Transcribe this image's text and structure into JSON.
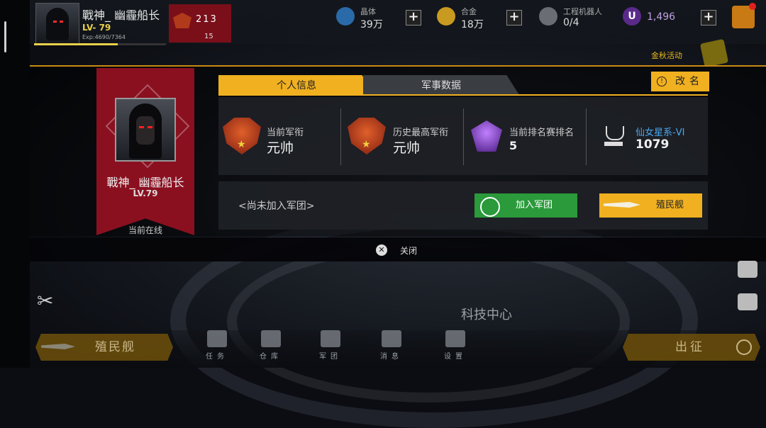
{
  "topbar": {
    "player_name": "戰神_ 幽霾船长",
    "level": "LV- 79",
    "exp": "Exp:4690/7364",
    "exp_fraction": 0.637,
    "rank_count": "15",
    "podium": "213",
    "resources": [
      {
        "label": "晶体",
        "value": "39万",
        "icon": "crystal-icon"
      },
      {
        "label": "合金",
        "value": "18万",
        "icon": "alloy-icon"
      },
      {
        "label": "工程机器人",
        "value": "0/4",
        "icon": "robot-icon"
      }
    ],
    "currency": "1,496",
    "event_label": "金秋活动"
  },
  "profile": {
    "name": "戰神_ 幽霾船长",
    "level": "LV.79",
    "status": "当前在线"
  },
  "tabs": [
    {
      "label": "个人信息",
      "active": true
    },
    {
      "label": "军事数据",
      "active": false
    }
  ],
  "rename_label": "改名",
  "stats": {
    "current_rank": {
      "label": "当前军衔",
      "value": "元帅"
    },
    "highest_rank": {
      "label": "历史最高军衔",
      "value": "元帅"
    },
    "arena_rank": {
      "label": "当前排名赛排名",
      "value": "5"
    },
    "galaxy": {
      "label": "仙女星系-VI",
      "value": "1079"
    }
  },
  "guild": {
    "status": "<尚未加入军团>",
    "join_label": "加入军团",
    "colony_label": "殖民舰"
  },
  "close_label": "关闭",
  "scene_label": "科技中心",
  "bottom": {
    "colony_label": "殖民舰",
    "nav": [
      {
        "label": "任务",
        "icon": "task-icon"
      },
      {
        "label": "仓库",
        "icon": "warehouse-icon"
      },
      {
        "label": "军团",
        "icon": "legion-icon"
      },
      {
        "label": "消息",
        "icon": "message-icon"
      },
      {
        "label": "设置",
        "icon": "settings-icon"
      }
    ],
    "go_label": "出征"
  },
  "colors": {
    "accent_gold": "#f0b020",
    "banner_red": "#8a1020",
    "join_green": "#2a9a3a",
    "galaxy_blue": "#4aa8f0"
  }
}
